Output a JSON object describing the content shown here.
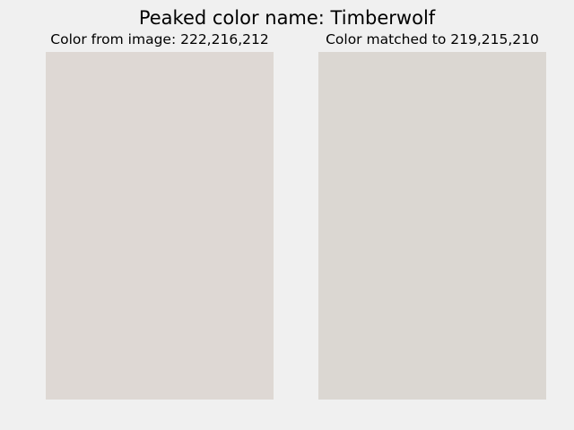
{
  "figure": {
    "title": "Peaked color name: Timberwolf"
  },
  "panels": {
    "source": {
      "title": "Color from image: 222,216,212",
      "swatch_color": "#ded8d4"
    },
    "matched": {
      "title": "Color matched to 219,215,210",
      "swatch_color": "#dbd7d2"
    }
  },
  "colors": {
    "background": "#f0f0f0",
    "text": "#000000"
  }
}
